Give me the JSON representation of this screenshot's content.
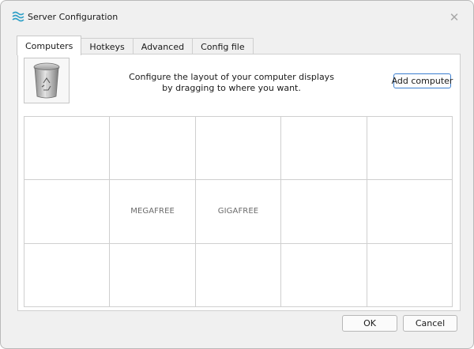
{
  "window": {
    "title": "Server Configuration",
    "close_glyph": "✕"
  },
  "icons": {
    "app": "wave-lines-icon",
    "trash": "recycle-bin-icon",
    "close": "close-icon"
  },
  "tabs": [
    {
      "label": "Computers",
      "active": true
    },
    {
      "label": "Hotkeys",
      "active": false
    },
    {
      "label": "Advanced",
      "active": false
    },
    {
      "label": "Config file",
      "active": false
    }
  ],
  "computers": {
    "instructions": "Configure the layout of your computer displays by dragging to where you want.",
    "add_button": "Add computer",
    "grid": {
      "columns": 5,
      "rows": 3,
      "cells": [
        "",
        "",
        "",
        "",
        "",
        "",
        "MEGAFREE",
        "GIGAFREE",
        "",
        "",
        "",
        "",
        "",
        "",
        ""
      ]
    }
  },
  "footer": {
    "ok": "OK",
    "cancel": "Cancel"
  },
  "colors": {
    "accent": "#3c7fd0",
    "app_icon": "#2fa0c7"
  }
}
